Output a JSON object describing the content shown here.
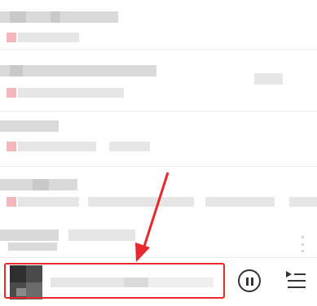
{
  "app": {
    "title": ""
  },
  "song_list": {
    "items": [
      {
        "title": "",
        "subtitle": ""
      },
      {
        "title": "",
        "subtitle": ""
      },
      {
        "title": "",
        "subtitle": ""
      },
      {
        "title": "",
        "subtitle": ""
      },
      {
        "title": "",
        "subtitle": ""
      }
    ]
  },
  "now_playing": {
    "track_title": "",
    "state": "playing",
    "controls": {
      "play_pause_icon": "pause-icon",
      "queue_icon": "playlist-icon"
    }
  },
  "annotation": {
    "color": "#e8282b",
    "shape": "arrow-and-box"
  },
  "colors": {
    "accent": "#e8282b",
    "text_dark": "#333333"
  }
}
